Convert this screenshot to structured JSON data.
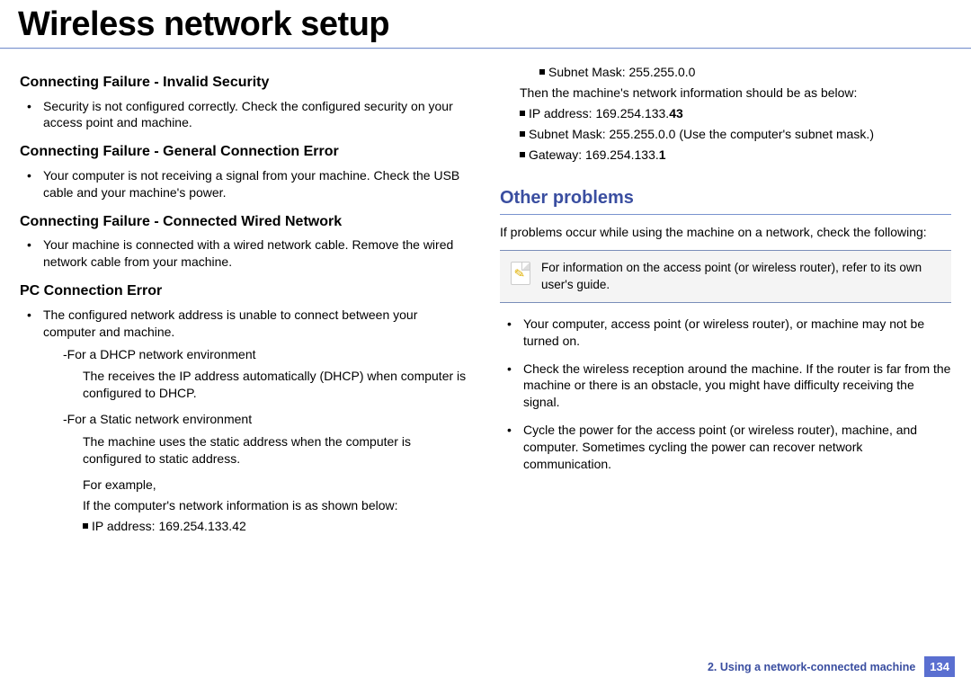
{
  "page_title": "Wireless network setup",
  "left": {
    "h_invalid": "Connecting Failure - Invalid Security",
    "p_invalid": "Security is not configured correctly. Check the configured security on your access point and machine.",
    "h_general": "Connecting Failure - General Connection Error",
    "p_general": "Your computer is not receiving a signal from your machine. Check the USB cable and your machine's power.",
    "h_wired": "Connecting Failure - Connected Wired Network",
    "p_wired": "Your machine is connected with a wired network cable. Remove the wired network cable from your machine.",
    "h_pc": "PC Connection Error",
    "p_pc_intro": "The configured network address is unable to connect between your computer and machine.",
    "dhcp_label": "For a DHCP network environment",
    "dhcp_text": "The receives the IP address automatically (DHCP) when computer is configured to DHCP.",
    "static_label": "For a Static network environment",
    "static_text": "The machine uses the static address when the computer is configured to static address.",
    "for_example": "For example,",
    "if_shown": "If the computer's network information is as shown below:",
    "ip_example": "IP address: 169.254.133.42"
  },
  "right": {
    "subnet_top": "Subnet Mask: 255.255.0.0",
    "then_line": "Then the machine's network information should be as below:",
    "ip_line_prefix": "IP address: 169.254.133.",
    "ip_line_bold": "43",
    "subnet_line": "Subnet Mask: 255.255.0.0 (Use the computer's subnet mask.)",
    "gateway_prefix": "Gateway: 169.254.133.",
    "gateway_bold": "1",
    "h_other": "Other problems",
    "p_other_intro": "If problems occur while using the machine on a network, check the following:",
    "note_text": "For information on the access point (or wireless router), refer to its own user's guide.",
    "b1": "Your computer, access point (or wireless router), or machine may not be turned on.",
    "b2": "Check the wireless reception around the machine. If the router is far from the machine or there is an obstacle, you might have difficulty receiving the signal.",
    "b3": "Cycle the power for the access point (or wireless router), machine, and computer. Sometimes cycling the power can recover network communication."
  },
  "footer": {
    "chapter": "2.  Using a network-connected machine",
    "page": "134"
  }
}
